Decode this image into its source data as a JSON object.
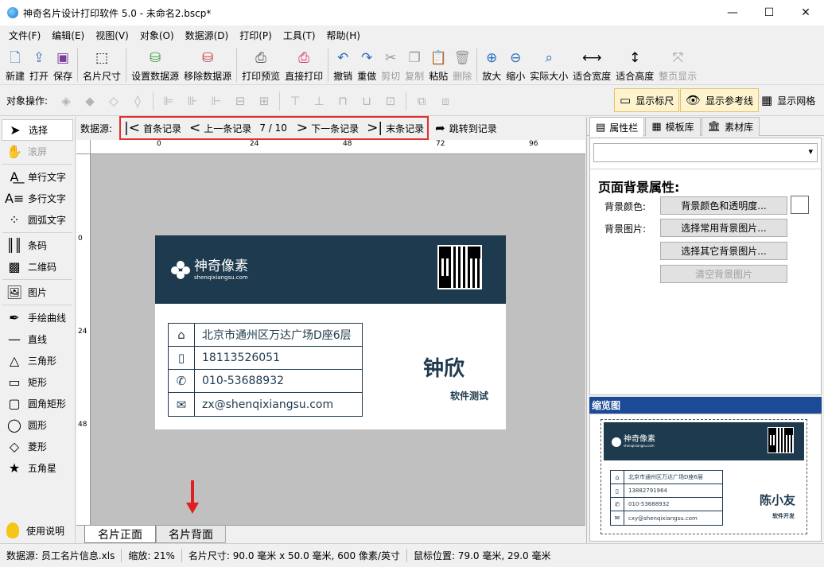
{
  "window": {
    "title": "神奇名片设计打印软件 5.0 - 未命名2.bscp*",
    "minimize": "—",
    "maximize": "☐",
    "close": "✕"
  },
  "menu": [
    "文件(F)",
    "编辑(E)",
    "视图(V)",
    "对象(O)",
    "数据源(D)",
    "打印(P)",
    "工具(T)",
    "帮助(H)"
  ],
  "toolbar": {
    "new": "新建",
    "open": "打开",
    "save": "保存",
    "card_size": "名片尺寸",
    "set_datasource": "设置数据源",
    "remove_datasource": "移除数据源",
    "print_preview": "打印预览",
    "direct_print": "直接打印",
    "undo": "撤销",
    "redo": "重做",
    "cut": "剪切",
    "copy": "复制",
    "paste": "粘贴",
    "delete": "删除",
    "zoom_in": "放大",
    "zoom_out": "缩小",
    "actual_size": "实际大小",
    "fit_width": "适合宽度",
    "fit_height": "适合高度",
    "fit_page": "整页显示"
  },
  "objbar": {
    "label": "对象操作:",
    "show_ruler": "显示标尺",
    "show_guides": "显示参考线",
    "show_grid": "显示网格"
  },
  "palette": {
    "select": "选择",
    "pan": "滚屏",
    "single_text": "单行文字",
    "multi_text": "多行文字",
    "arc_text": "圆弧文字",
    "barcode": "条码",
    "qrcode": "二维码",
    "image": "图片",
    "freehand": "手绘曲线",
    "line": "直线",
    "triangle": "三角形",
    "rect": "矩形",
    "round_rect": "圆角矩形",
    "ellipse": "圆形",
    "diamond": "菱形",
    "star": "五角星",
    "help": "使用说明"
  },
  "datanav": {
    "label": "数据源:",
    "first": "首条记录",
    "prev": "上一条记录",
    "counter": "7 / 10",
    "next": "下一条记录",
    "last": "末条记录",
    "jump": "跳转到记录"
  },
  "rulers": {
    "h": [
      "0",
      "24",
      "48",
      "72",
      "96"
    ],
    "v": [
      "0",
      "24",
      "48"
    ]
  },
  "card": {
    "brand": "神奇像素",
    "url": "shenqixiangsu.com",
    "address": "北京市通州区万达广场D座6层",
    "phone": "18113526051",
    "tel": "010-53688932",
    "email": "zx@shenqixiangsu.com",
    "name": "钟欣",
    "title": "软件测试"
  },
  "pagetabs": {
    "front": "名片正面",
    "back": "名片背面"
  },
  "rpanel": {
    "tab_props": "属性栏",
    "tab_templates": "模板库",
    "tab_assets": "素材库",
    "section_title": "页面背景属性:",
    "bg_color_label": "背景颜色:",
    "bg_color_button": "背景颜色和透明度...",
    "bg_image_label": "背景图片:",
    "choose_common_bg": "选择常用背景图片...",
    "choose_other_bg": "选择其它背景图片...",
    "clear_bg": "清空背景图片",
    "preview_title": "缩览图"
  },
  "preview": {
    "brand": "神奇像素",
    "url": "shenqixiangsu.com",
    "address": "北京市通州区万达广场D座6层",
    "phone": "13882791964",
    "tel": "010-53688932",
    "email": "cxy@shenqixiangsu.com",
    "name": "陈小友",
    "title": "软件开发"
  },
  "statusbar": {
    "datasource": "数据源: 员工名片信息.xls",
    "zoom": "缩放: 21%",
    "card_size": "名片尺寸: 90.0 毫米 x 50.0 毫米, 600 像素/英寸",
    "mouse_pos": "鼠标位置: 79.0 毫米, 29.0 毫米"
  },
  "colors": {
    "card_header": "#1e3a4e",
    "nav_highlight": "#e03030",
    "preview_header": "#1c4a96"
  }
}
